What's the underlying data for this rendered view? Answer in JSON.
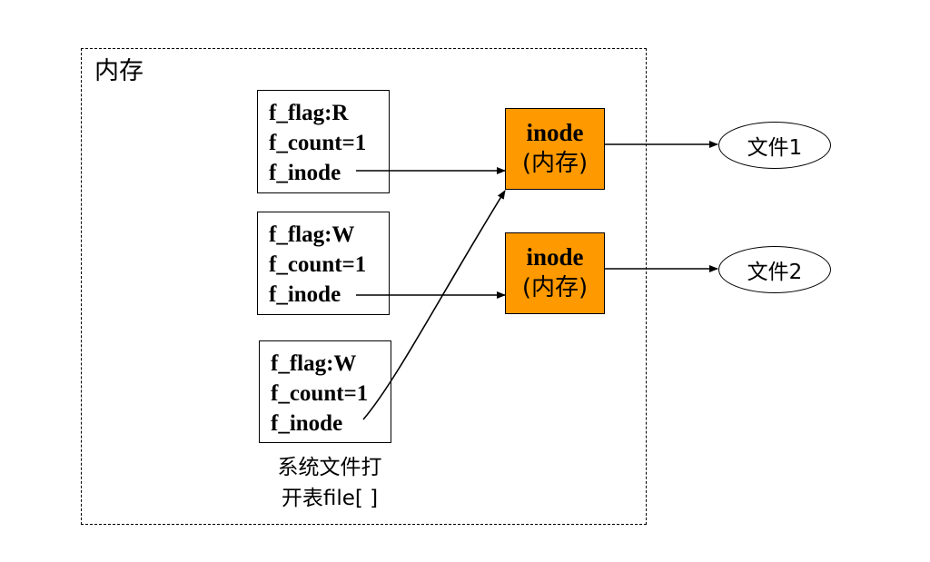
{
  "memory_region": {
    "label": "内存"
  },
  "file_table": {
    "entries": [
      {
        "flag": "f_flag:R",
        "count": "f_count=1",
        "inode": "f_inode"
      },
      {
        "flag": "f_flag:W",
        "count": "f_count=1",
        "inode": "f_inode"
      },
      {
        "flag": "f_flag:W",
        "count": "f_count=1",
        "inode": "f_inode"
      }
    ],
    "caption_line1": "系统文件打",
    "caption_line2": "开表file[ ]"
  },
  "inodes": [
    {
      "title": "inode",
      "subtitle": "(内存)"
    },
    {
      "title": "inode",
      "subtitle": "(内存)"
    }
  ],
  "disk_files": [
    {
      "label": "文件1"
    },
    {
      "label": "文件2"
    }
  ],
  "colors": {
    "inode_fill": "#ff9900",
    "line": "#000000",
    "background": "#ffffff"
  }
}
